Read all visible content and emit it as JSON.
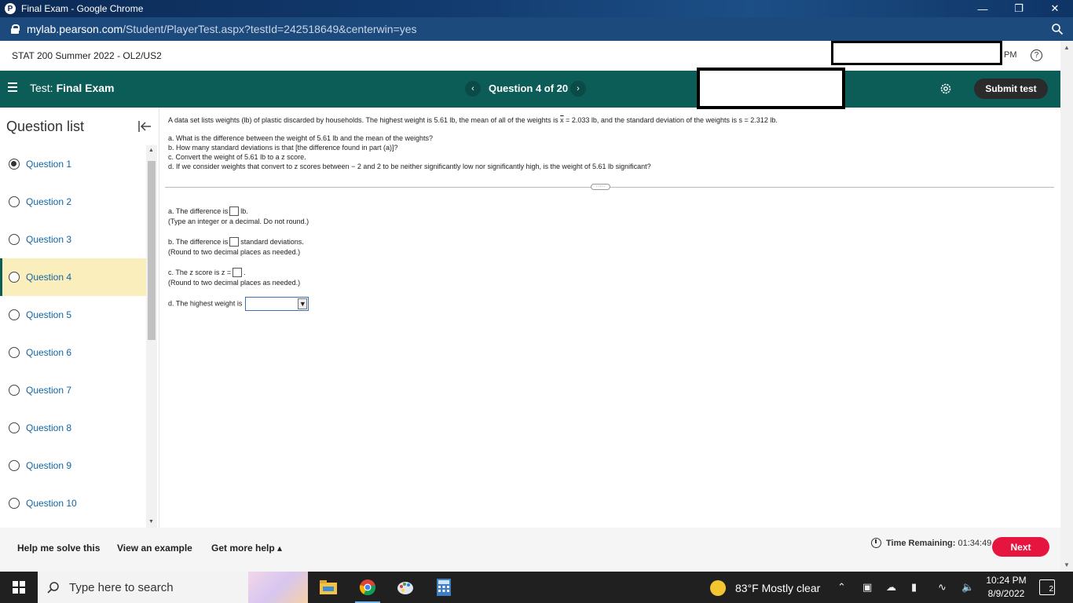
{
  "browser": {
    "window_title": "Final Exam - Google Chrome",
    "url_host": "mylab.pearson.com",
    "url_path": "/Student/PlayerTest.aspx?testId=242518649&centerwin=yes"
  },
  "course": {
    "name": "STAT 200 Summer 2022 - OL2/US2",
    "time_fragment": "PM"
  },
  "test_header": {
    "test_prefix": "Test:",
    "test_name": "Final Exam",
    "question_position": "Question 4 of 20",
    "submit_label": "Submit test"
  },
  "sidebar": {
    "title": "Question list",
    "items": [
      {
        "label": "Question 1",
        "state": "answered"
      },
      {
        "label": "Question 2",
        "state": "unanswered"
      },
      {
        "label": "Question 3",
        "state": "unanswered"
      },
      {
        "label": "Question 4",
        "state": "current"
      },
      {
        "label": "Question 5",
        "state": "unanswered"
      },
      {
        "label": "Question 6",
        "state": "unanswered"
      },
      {
        "label": "Question 7",
        "state": "unanswered"
      },
      {
        "label": "Question 8",
        "state": "unanswered"
      },
      {
        "label": "Question 9",
        "state": "unanswered"
      },
      {
        "label": "Question 10",
        "state": "unanswered"
      }
    ]
  },
  "question": {
    "prompt_1": "A data set lists weights (lb) of plastic discarded by households. The highest weight is 5.61 lb, the mean of all of the weights is",
    "xbar_symbol": "x",
    "prompt_2": "= 2.033 lb, and the standard deviation of the weights is s = 2.312 lb.",
    "part_a": "a. What is the difference between the weight of 5.61 lb and the mean of the weights?",
    "part_b": "b. How many standard deviations is that [the difference found in part (a)]?",
    "part_c": "c. Convert the weight of 5.61 lb to a z score.",
    "part_d": "d. If we consider weights that convert to z scores between − 2 and 2 to be neither significantly low nor significantly high, is the weight of 5.61 lb significant?",
    "expander": "·····"
  },
  "answers": {
    "a_before": "a. The difference is",
    "a_after": "lb.",
    "a_hint": "(Type an integer or a decimal. Do not round.)",
    "b_before": "b. The difference is",
    "b_after": "standard deviations.",
    "b_hint": "(Round to two decimal places as needed.)",
    "c_before": "c. The z score is z =",
    "c_after": ".",
    "c_hint": "(Round to two decimal places as needed.)",
    "d_before": "d. The highest weight is",
    "d_selected": ""
  },
  "footer": {
    "help_solve": "Help me solve this",
    "view_example": "View an example",
    "get_help": "Get more help ▴",
    "time_label": "Time Remaining:",
    "time_value": "01:34:49",
    "next_label": "Next"
  },
  "taskbar": {
    "search_placeholder": "Type here to search",
    "weather": "83°F  Mostly clear",
    "time": "10:24 PM",
    "date": "8/9/2022",
    "notifications": "2"
  },
  "colors": {
    "teal_header": "#0c5c58",
    "next_button": "#e5153f",
    "current_question_bg": "#fbeebd",
    "link_blue": "#1264a3"
  }
}
